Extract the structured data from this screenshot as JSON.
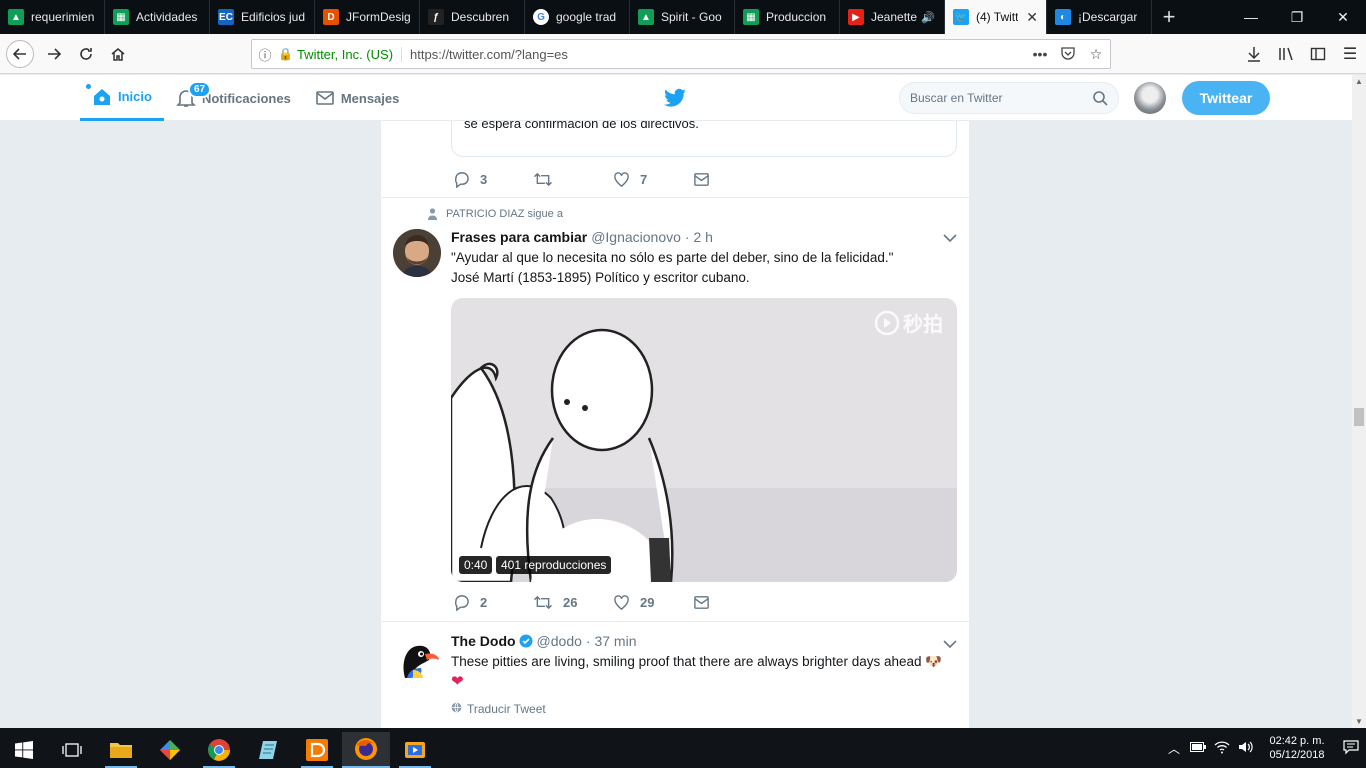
{
  "browser": {
    "tabs": [
      {
        "title": "requerimien",
        "fav_color": "#0f9d58",
        "fav_glyph": "▲"
      },
      {
        "title": "Actividades",
        "fav_color": "#0f9d58",
        "fav_glyph": "▦"
      },
      {
        "title": "Edificios jud",
        "fav_color": "#1565c0",
        "fav_glyph": "EC"
      },
      {
        "title": "JFormDesig",
        "fav_color": "#e65100",
        "fav_glyph": "D"
      },
      {
        "title": "Descubren",
        "fav_color": "#222222",
        "fav_glyph": "ƒ"
      },
      {
        "title": "google trad",
        "fav_color": "#ffffff",
        "fav_glyph": "G"
      },
      {
        "title": "Spirit - Goo",
        "fav_color": "#0f9d58",
        "fav_glyph": "▲"
      },
      {
        "title": "Produccion",
        "fav_color": "#0f9d58",
        "fav_glyph": "▦"
      },
      {
        "title": "Jeanette",
        "fav_color": "#e62117",
        "fav_glyph": "▶"
      },
      {
        "title": "(4) Twitt",
        "fav_color": "#1da1f2",
        "fav_glyph": "🐦"
      },
      {
        "title": "¡Descargar",
        "fav_color": "#1e88e5",
        "fav_glyph": "◐"
      }
    ],
    "identity": "Twitter, Inc. (US)",
    "url": "https://twitter.com/?lang=es"
  },
  "twitter": {
    "nav": {
      "home": "Inicio",
      "notifications": "Notificaciones",
      "notifications_count": "67",
      "messages": "Mensajes"
    },
    "search_placeholder": "Buscar en Twitter",
    "tweet_button": "Twittear",
    "accent": "#1da1f2"
  },
  "timeline": {
    "tweet0": {
      "quote_text": "se espera confirmación de los directivos.",
      "replies": "3",
      "likes": "7"
    },
    "tweet1": {
      "context": "PATRICIO DIAZ sigue a",
      "name": "Frases para cambiar",
      "handle": "@Ignacionovo",
      "time": "· 2 h",
      "line1": "\"Ayudar al que lo necesita no sólo es parte del deber, sino de la felicidad.\"",
      "line2": "José Martí (1853-1895) Político y escritor cubano.",
      "video_duration": "0:40",
      "video_views": "401 reproducciones",
      "replies": "2",
      "retweets": "26",
      "likes": "29"
    },
    "tweet2": {
      "name": "The Dodo",
      "handle": "@dodo",
      "time": "· 37 min",
      "text": "These pitties are living, smiling proof that there are always brighter days ahead 🐶",
      "heart": "❤",
      "translate": "Traducir Tweet"
    }
  },
  "taskbar": {
    "time": "02:42 p. m.",
    "date": "05/12/2018"
  }
}
